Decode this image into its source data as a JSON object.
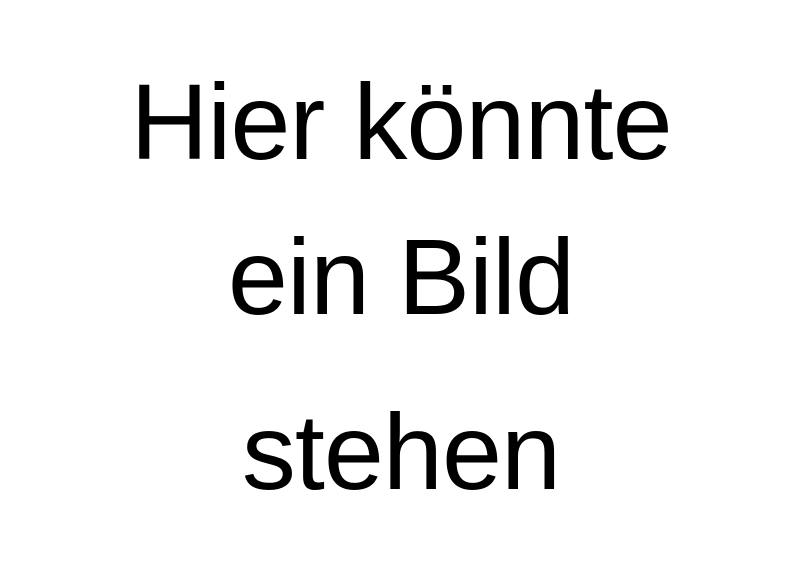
{
  "placeholder": {
    "lines": [
      "Hier könnte",
      "ein Bild",
      "stehen"
    ]
  },
  "colors": {
    "background": "#ffffff",
    "text": "#000000"
  }
}
